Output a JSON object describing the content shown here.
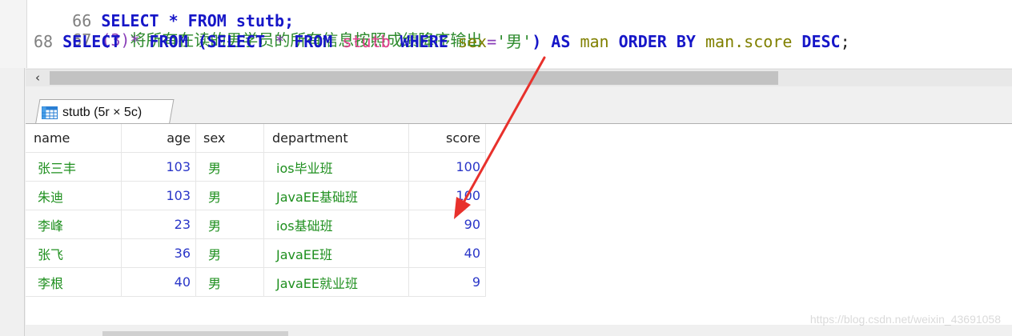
{
  "editor": {
    "line66": {
      "num": "66",
      "code": "SELECT * FROM stutb;"
    },
    "line67": {
      "num": "67",
      "paren_num": "(3)",
      "comment": "将所有在读的男学员的所有信息按照成绩降序输出"
    },
    "line68": {
      "num": "68",
      "kw_select": "SELECT",
      "star": "*",
      "kw_from": "FROM",
      "open_paren": "(",
      "kw_select2": "SELECT",
      "star2": "*",
      "kw_from2": "FROM",
      "table": "stutb",
      "kw_where": "WHERE",
      "col_sex": "sex",
      "eq": "=",
      "str": "'男'",
      "close_paren": ")",
      "kw_as": "AS",
      "alias": "man",
      "kw_order": "ORDER BY",
      "col_score": "man.score",
      "kw_desc": "DESC",
      "semicolon": ";"
    }
  },
  "scrollbar": {
    "left_arrow": "‹"
  },
  "result_tab": {
    "label": "stutb (5r × 5c)",
    "icon": "table-grid-icon"
  },
  "grid": {
    "columns": [
      "name",
      "age",
      "sex",
      "department",
      "score"
    ],
    "rows": [
      {
        "name": "张三丰",
        "age": "103",
        "sex": "男",
        "department": "ios毕业班",
        "score": "100"
      },
      {
        "name": "朱迪",
        "age": "103",
        "sex": "男",
        "department": "JavaEE基础班",
        "score": "100"
      },
      {
        "name": "李峰",
        "age": "23",
        "sex": "男",
        "department": "ios基础班",
        "score": "90"
      },
      {
        "name": "张飞",
        "age": "36",
        "sex": "男",
        "department": "JavaEE班",
        "score": "40"
      },
      {
        "name": "李根",
        "age": "40",
        "sex": "男",
        "department": "JavaEE就业班",
        "score": "9"
      }
    ]
  },
  "watermark": "https://blog.csdn.net/weixin_43691058",
  "colors": {
    "keyword": "#1616c8",
    "comment": "#2e8b2e",
    "table_name": "#e63b8f",
    "column": "#808000",
    "text_value": "#1e8f1e",
    "number_value": "#2a36c8",
    "arrow": "#e8312c"
  }
}
